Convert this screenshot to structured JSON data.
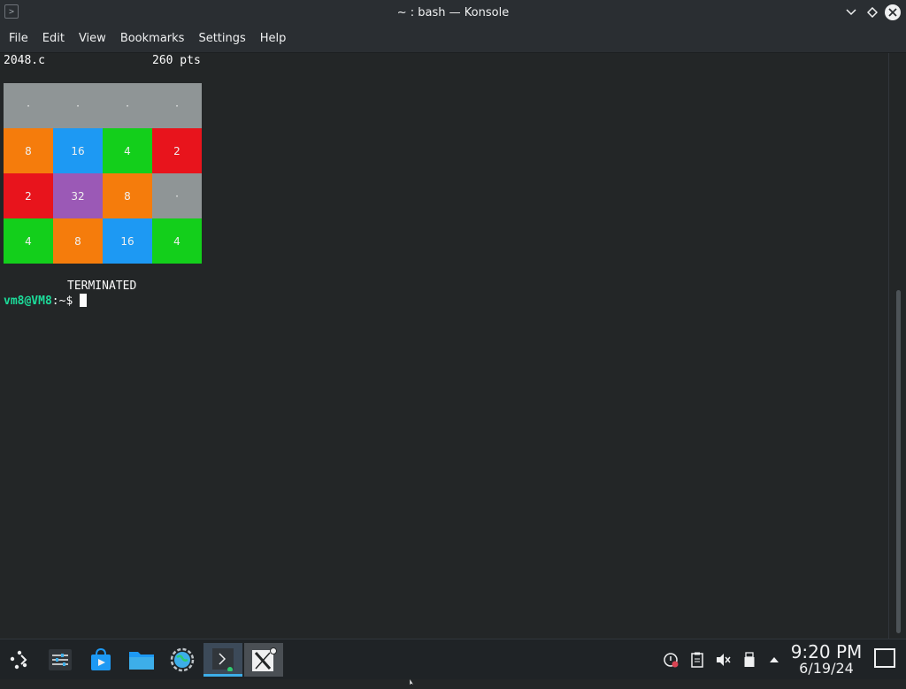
{
  "window": {
    "title": "~ : bash — Konsole",
    "controls": [
      "minimize",
      "maximize",
      "close"
    ]
  },
  "menu": [
    "File",
    "Edit",
    "View",
    "Bookmarks",
    "Settings",
    "Help"
  ],
  "terminal": {
    "game_name": "2048.c",
    "score": "260 pts",
    "board": [
      [
        "·",
        "·",
        "·",
        "·"
      ],
      [
        "8",
        "16",
        "4",
        "2"
      ],
      [
        "2",
        "32",
        "8",
        "·"
      ],
      [
        "4",
        "8",
        "16",
        "4"
      ]
    ],
    "tile_colors": {
      "·": "#8f9596",
      "2": "#e8141c",
      "4": "#13cf1b",
      "8": "#f57c0c",
      "16": "#1d99f3",
      "32": "#9b59b6"
    },
    "status": "TERMINATED",
    "prompt_user": "vm8@VM8",
    "prompt_rest": ":~$"
  },
  "taskbar": {
    "launchers": [
      "application-launcher-icon",
      "system-settings-icon",
      "discover-store-icon",
      "dolphin-files-icon",
      "web-browser-icon",
      "konsole-icon",
      "x11-icon"
    ],
    "tray": [
      "updates-icon",
      "clipboard-icon",
      "volume-muted-icon",
      "usb-device-icon",
      "tray-expand-icon"
    ],
    "time": "9:20 PM",
    "date": "6/19/24"
  },
  "colors": {
    "accent": "#3daee9",
    "prompt_user": "#1cdc9a",
    "background": "#232627"
  }
}
